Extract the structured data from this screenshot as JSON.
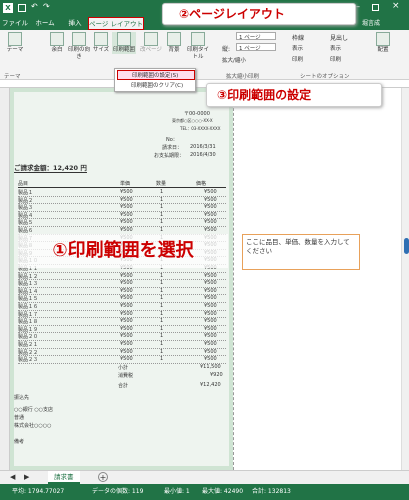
{
  "title_bar": {
    "quick_access": [
      "save-icon",
      "undo-icon",
      "redo-icon"
    ],
    "file_name": "20160"
  },
  "tabs": [
    "ファイル",
    "ホーム",
    "挿入",
    "ページ レイアウト"
  ],
  "user": "堀言成",
  "ribbon": {
    "buttons": [
      "テーマ",
      "余白",
      "印刷の向き",
      "サイズ",
      "印刷範囲",
      "改ページ",
      "背景",
      "印刷タイトル"
    ],
    "scale": {
      "height_label": "縦:",
      "height_value": "1 ページ",
      "width_value": "1 ページ",
      "scale_label": "拡大/縮小"
    },
    "gridlines": {
      "title": "枠線",
      "view": "表示",
      "print": "印刷"
    },
    "headings": {
      "title": "見出し",
      "view": "表示",
      "print": "印刷"
    },
    "arrange": "配置",
    "groups": [
      "テーマ",
      "拡大縮小印刷",
      "シートのオプション"
    ]
  },
  "print_area_menu": {
    "set": "印刷範囲の設定(S)",
    "clear": "印刷範囲のクリア(C)"
  },
  "callouts": {
    "page_layout": "②ページレイアウト",
    "set_print_area": "③印刷範囲の設定",
    "select_area": "①印刷範囲を選択"
  },
  "invoice": {
    "postal": "〒00-0000",
    "address": "東京都○区○○○-XX-X",
    "tel": "TEL：03-XXXX-XXXX",
    "no_label": "No：",
    "issue_date_label": "請求日：",
    "issue_date": "2016/3/31",
    "due_label": "お支払期限：",
    "due_date": "2016/4/30",
    "total_label": "ご請求金額：12,420 円",
    "headers": {
      "item": "品目",
      "unit": "単価",
      "qty": "数量",
      "price": "価格"
    },
    "rows": [
      {
        "item": "製品１",
        "unit": "¥500",
        "qty": "1",
        "price": "¥500"
      },
      {
        "item": "製品２",
        "unit": "¥500",
        "qty": "1",
        "price": "¥500"
      },
      {
        "item": "製品３",
        "unit": "¥500",
        "qty": "1",
        "price": "¥500"
      },
      {
        "item": "製品４",
        "unit": "¥500",
        "qty": "1",
        "price": "¥500"
      },
      {
        "item": "製品５",
        "unit": "¥500",
        "qty": "1",
        "price": "¥500"
      },
      {
        "item": "製品６",
        "unit": "¥500",
        "qty": "1",
        "price": "¥500"
      },
      {
        "item": "製品７",
        "unit": "¥500",
        "qty": "1",
        "price": "¥500"
      },
      {
        "item": "製品８",
        "unit": "¥500",
        "qty": "1",
        "price": "¥500"
      },
      {
        "item": "製品９",
        "unit": "¥500",
        "qty": "1",
        "price": "¥500"
      },
      {
        "item": "製品１０",
        "unit": "¥500",
        "qty": "1",
        "price": "¥500"
      },
      {
        "item": "製品１１",
        "unit": "¥500",
        "qty": "1",
        "price": "¥500"
      },
      {
        "item": "製品１２",
        "unit": "¥500",
        "qty": "1",
        "price": "¥500"
      },
      {
        "item": "製品１３",
        "unit": "¥500",
        "qty": "1",
        "price": "¥500"
      },
      {
        "item": "製品１４",
        "unit": "¥500",
        "qty": "1",
        "price": "¥500"
      },
      {
        "item": "製品１５",
        "unit": "¥500",
        "qty": "1",
        "price": "¥500"
      },
      {
        "item": "製品１６",
        "unit": "¥500",
        "qty": "1",
        "price": "¥500"
      },
      {
        "item": "製品１７",
        "unit": "¥500",
        "qty": "1",
        "price": "¥500"
      },
      {
        "item": "製品１８",
        "unit": "¥500",
        "qty": "1",
        "price": "¥500"
      },
      {
        "item": "製品１９",
        "unit": "¥500",
        "qty": "1",
        "price": "¥500"
      },
      {
        "item": "製品２０",
        "unit": "¥500",
        "qty": "1",
        "price": "¥500"
      },
      {
        "item": "製品２１",
        "unit": "¥500",
        "qty": "1",
        "price": "¥500"
      },
      {
        "item": "製品２２",
        "unit": "¥500",
        "qty": "1",
        "price": "¥500"
      },
      {
        "item": "製品２３",
        "unit": "¥500",
        "qty": "1",
        "price": "¥500"
      }
    ],
    "subtotal_label": "小計",
    "subtotal": "¥11,500",
    "tax_label": "消費税",
    "tax": "¥920",
    "grand_label": "合計",
    "grand": "¥12,420",
    "remarks_label": "振込先",
    "bank": "○○銀行 ○○支店",
    "account_type": "普通",
    "account_holder": "株式会社○○○○",
    "notes_label": "備考"
  },
  "comment_box": "ここに品目、単価、数量を入力してください",
  "sheet_tab": "請求書",
  "status": {
    "average": "平均: 1794.77027",
    "count": "データの個数: 119",
    "min": "最小値: 1",
    "max": "最大値: 42490",
    "sum": "合計: 132813"
  }
}
